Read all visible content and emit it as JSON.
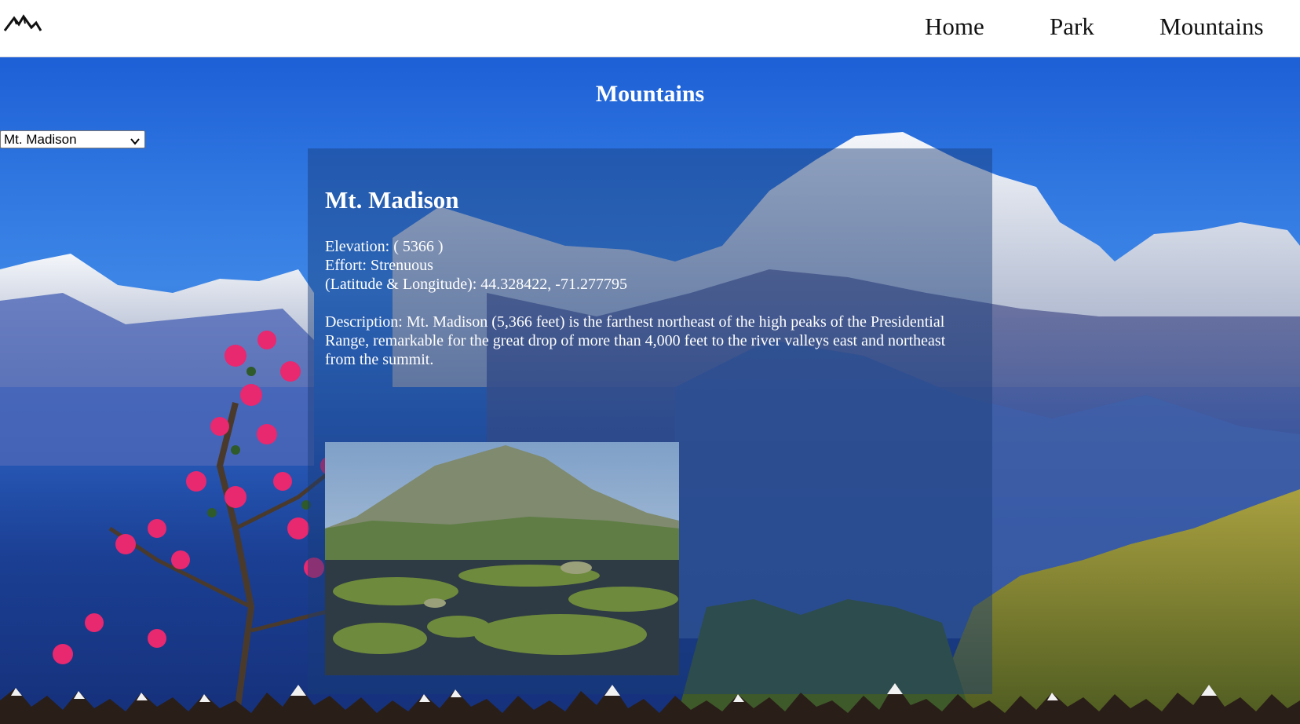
{
  "header": {
    "logo_icon": "mountain-logo-icon",
    "nav": {
      "home": "Home",
      "park": "Park",
      "mountains": "Mountains"
    }
  },
  "hero": {
    "title": "Mountains",
    "select": {
      "selected": "Mt. Madison"
    }
  },
  "mountain": {
    "name": "Mt. Madison",
    "elevation_line": "Elevation: ( 5366 )",
    "effort_line": "Effort: Strenuous",
    "coords_line": "(Latitude & Longitude): 44.328422, -71.277795",
    "description": "Description: Mt. Madison (5,366 feet) is the farthest northeast of the high peaks of the Presidential Range, remarkable for the great drop of more than 4,000 feet to the river valleys east and northeast from the summit."
  },
  "colors": {
    "card_overlay": "rgba(25, 60, 120, 0.45)",
    "sky_blue": "#2f76e0",
    "ridge_dark": "#2a1e18"
  }
}
